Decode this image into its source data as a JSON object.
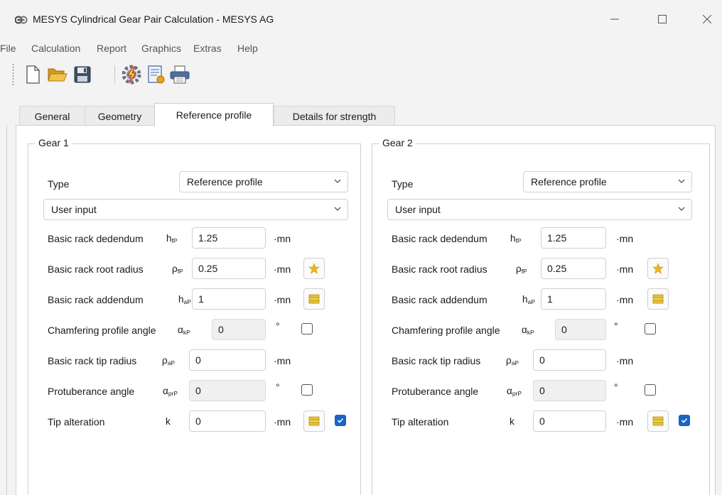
{
  "window": {
    "title": "MESYS Cylindrical Gear Pair Calculation - MESYS AG"
  },
  "menu": [
    "File",
    "Calculation",
    "Report",
    "Graphics",
    "Extras",
    "Help"
  ],
  "toolbar": {
    "icons": [
      "new-file-icon",
      "open-folder-icon",
      "save-icon",
      "calculate-icon",
      "report-icon",
      "print-icon"
    ]
  },
  "tabs": [
    "General",
    "Geometry",
    "Reference profile",
    "Details for strength"
  ],
  "active_tab": "Reference profile",
  "labels": {
    "type": "Type",
    "dedendum": "Basic rack dedendum",
    "root_radius": "Basic rack root radius",
    "addendum": "Basic rack addendum",
    "chamfer_angle": "Chamfering profile angle",
    "tip_radius": "Basic rack tip radius",
    "protuberance": "Protuberance angle",
    "tip_alteration": "Tip alteration"
  },
  "symbols": {
    "dedendum": {
      "base": "h",
      "sub": "fP"
    },
    "root_radius": {
      "base": "ρ",
      "sub": "fP"
    },
    "addendum": {
      "base": "h",
      "sub": "aP"
    },
    "chamfer_angle": {
      "base": "α",
      "sub": "kP"
    },
    "tip_radius": {
      "base": "ρ",
      "sub": "aP"
    },
    "protuberance": {
      "base": "α",
      "sub": "prP"
    },
    "tip_alteration": {
      "base": "k",
      "sub": ""
    }
  },
  "units": {
    "mn": "·mn",
    "deg": "°"
  },
  "gears": [
    {
      "title": "Gear 1",
      "type_value": "Reference profile",
      "input_mode": "User input",
      "dedendum": "1.25",
      "root_radius": "0.25",
      "addendum": "1",
      "chamfer_angle": "0",
      "chamfer_checked": false,
      "tip_radius": "0",
      "protuberance": "0",
      "protuberance_checked": false,
      "tip_alteration": "0",
      "tip_alteration_checked": true
    },
    {
      "title": "Gear 2",
      "type_value": "Reference profile",
      "input_mode": "User input",
      "dedendum": "1.25",
      "root_radius": "0.25",
      "addendum": "1",
      "chamfer_angle": "0",
      "chamfer_checked": false,
      "tip_radius": "0",
      "protuberance": "0",
      "protuberance_checked": false,
      "tip_alteration": "0",
      "tip_alteration_checked": true
    }
  ],
  "colors": {
    "accent": "#1b63c5",
    "star": "#f0b51c",
    "stack": "#e8c23a"
  }
}
